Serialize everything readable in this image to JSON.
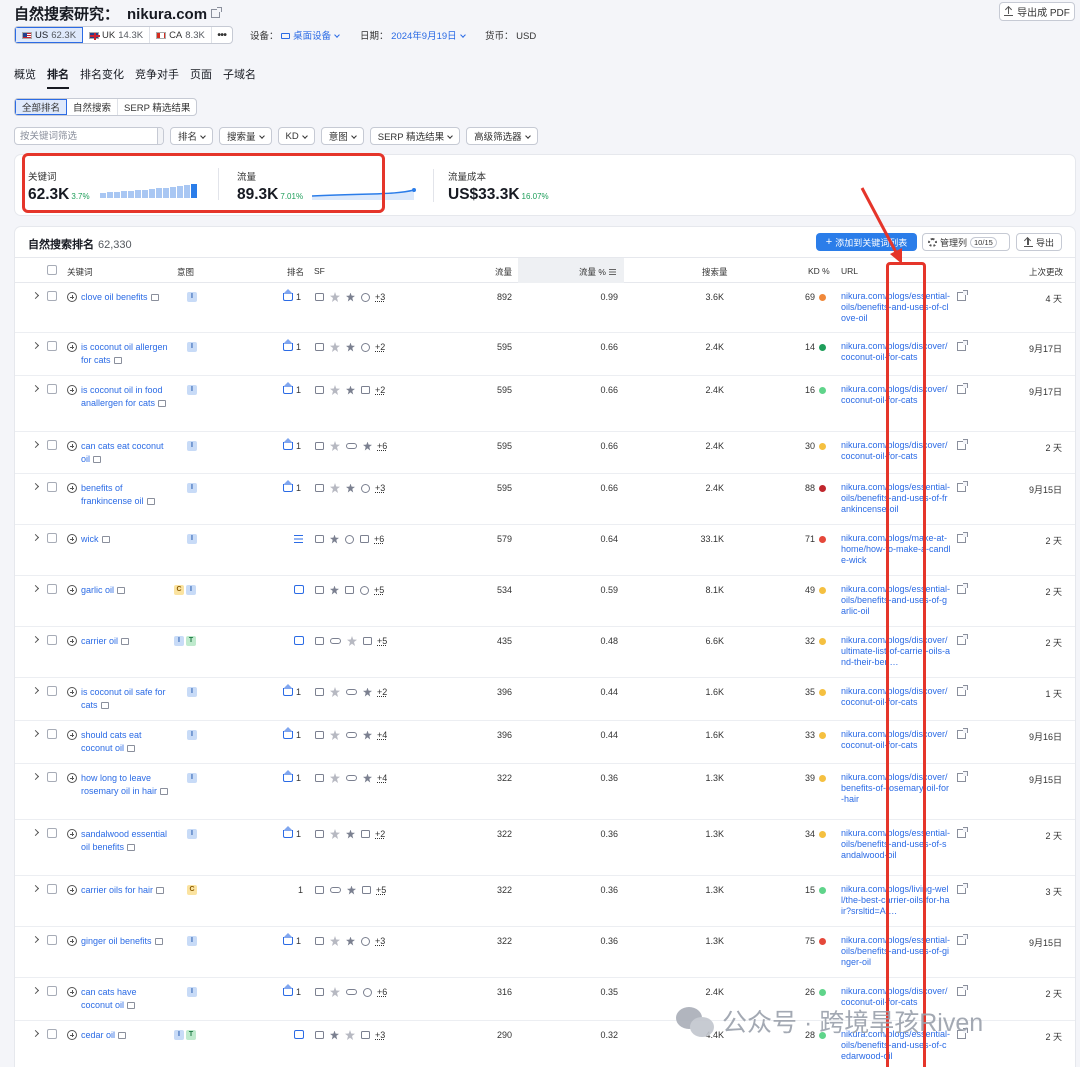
{
  "header": {
    "title": "自然搜索研究：",
    "domain": "nikura.com",
    "export_pdf": "导出成 PDF",
    "databases": [
      {
        "code": "US",
        "count": "62.3K",
        "flag": "us",
        "active": true
      },
      {
        "code": "UK",
        "count": "14.3K",
        "flag": "uk",
        "active": false
      },
      {
        "code": "CA",
        "count": "8.3K",
        "flag": "ca",
        "active": false
      }
    ],
    "more": "•••",
    "device_label": "设备：",
    "device_value": "桌面设备",
    "date_label": "日期：",
    "date_value": "2024年9月19日",
    "currency_label": "货币：",
    "currency_value": "USD"
  },
  "tabs": [
    "概览",
    "排名",
    "排名变化",
    "竞争对手",
    "页面",
    "子域名"
  ],
  "active_tab": 1,
  "subtabs": [
    "全部排名",
    "自然搜索",
    "SERP 精选结果"
  ],
  "filters": {
    "search_placeholder": "按关键词筛选",
    "buttons": [
      "排名",
      "搜索量",
      "KD",
      "意图",
      "SERP 精选结果",
      "高级筛选器"
    ]
  },
  "summary": {
    "keywords": {
      "label": "关键词",
      "value": "62.3K",
      "pct": "3.7%"
    },
    "traffic": {
      "label": "流量",
      "value": "89.3K",
      "pct": "7.01%"
    },
    "traffic_cost": {
      "label": "流量成本",
      "value": "US$33.3K",
      "pct": "16.07%"
    },
    "keyword_bars": [
      5,
      6,
      6,
      7,
      7,
      8,
      8,
      9,
      10,
      10,
      11,
      12,
      13,
      14
    ]
  },
  "table": {
    "title": "自然搜索排名",
    "count": "62,330",
    "add_button": "添加到关键词列表",
    "manage_button": "管理列",
    "manage_count": "10/15",
    "export_button": "导出",
    "columns": {
      "keyword": "关键词",
      "intent": "意图",
      "position": "排名",
      "sf": "SF",
      "traffic": "流量",
      "traffic_pct": "流量 %",
      "volume": "搜索量",
      "kd": "KD %",
      "url": "URL",
      "updated": "上次更改"
    },
    "rows": [
      {
        "keyword": "clove oil benefits",
        "intent": [
          "I"
        ],
        "pos": "1",
        "pos_type": "crown",
        "sf_more": "+3",
        "traffic": "892",
        "pct": "0.99",
        "volume": "3.6K",
        "kd": "69",
        "kd_color": "#f0883a",
        "url": "nikura.com/blogs/essential-oils/benefits-and-uses-of-clove-oil",
        "updated": "4 天"
      },
      {
        "keyword": "is coconut oil allergen for cats",
        "intent": [
          "I"
        ],
        "pos": "1",
        "pos_type": "crown",
        "sf_more": "+2",
        "traffic": "595",
        "pct": "0.66",
        "volume": "2.4K",
        "kd": "14",
        "kd_color": "#1e9e5a",
        "url": "nikura.com/blogs/discover/coconut-oil-for-cats",
        "updated": "9月17日"
      },
      {
        "keyword": "is coconut oil in food anallergen for cats",
        "intent": [
          "I"
        ],
        "pos": "1",
        "pos_type": "crown",
        "sf_more": "+2",
        "traffic": "595",
        "pct": "0.66",
        "volume": "2.4K",
        "kd": "16",
        "kd_color": "#5fd48a",
        "url": "nikura.com/blogs/discover/coconut-oil-for-cats",
        "updated": "9月17日"
      },
      {
        "keyword": "can cats eat coconut oil",
        "intent": [
          "I"
        ],
        "pos": "1",
        "pos_type": "crown",
        "sf_more": "+6",
        "traffic": "595",
        "pct": "0.66",
        "volume": "2.4K",
        "kd": "30",
        "kd_color": "#f5c040",
        "url": "nikura.com/blogs/discover/coconut-oil-for-cats",
        "updated": "2 天"
      },
      {
        "keyword": "benefits of frankincense oil",
        "intent": [
          "I"
        ],
        "pos": "1",
        "pos_type": "crown",
        "sf_more": "+3",
        "traffic": "595",
        "pct": "0.66",
        "volume": "2.4K",
        "kd": "88",
        "kd_color": "#c0262d",
        "url": "nikura.com/blogs/essential-oils/benefits-and-uses-of-frankincense-oil",
        "updated": "9月15日"
      },
      {
        "keyword": "wick",
        "intent": [
          "I"
        ],
        "pos": "",
        "pos_type": "list",
        "sf_more": "+6",
        "traffic": "579",
        "pct": "0.64",
        "volume": "33.1K",
        "kd": "71",
        "kd_color": "#e5483a",
        "url": "nikura.com/blogs/make-at-home/how-to-make-a-candle-wick",
        "updated": "2 天"
      },
      {
        "keyword": "garlic oil",
        "intent": [
          "C",
          "I"
        ],
        "pos": "",
        "pos_type": "chat",
        "sf_more": "+5",
        "traffic": "534",
        "pct": "0.59",
        "volume": "8.1K",
        "kd": "49",
        "kd_color": "#f5c040",
        "url": "nikura.com/blogs/essential-oils/benefits-and-uses-of-garlic-oil",
        "updated": "2 天"
      },
      {
        "keyword": "carrier oil",
        "intent": [
          "I",
          "T"
        ],
        "pos": "",
        "pos_type": "chat",
        "sf_more": "+5",
        "traffic": "435",
        "pct": "0.48",
        "volume": "6.6K",
        "kd": "32",
        "kd_color": "#f5c040",
        "url": "nikura.com/blogs/discover/ultimate-list-of-carrier-oils-and-their-ben…",
        "updated": "2 天"
      },
      {
        "keyword": "is coconut oil safe for cats",
        "intent": [
          "I"
        ],
        "pos": "1",
        "pos_type": "crown",
        "sf_more": "+2",
        "traffic": "396",
        "pct": "0.44",
        "volume": "1.6K",
        "kd": "35",
        "kd_color": "#f5c040",
        "url": "nikura.com/blogs/discover/coconut-oil-for-cats",
        "updated": "1 天"
      },
      {
        "keyword": "should cats eat coconut oil",
        "intent": [
          "I"
        ],
        "pos": "1",
        "pos_type": "crown",
        "sf_more": "+4",
        "traffic": "396",
        "pct": "0.44",
        "volume": "1.6K",
        "kd": "33",
        "kd_color": "#f5c040",
        "url": "nikura.com/blogs/discover/coconut-oil-for-cats",
        "updated": "9月16日"
      },
      {
        "keyword": "how long to leave rosemary oil in hair",
        "intent": [
          "I"
        ],
        "pos": "1",
        "pos_type": "crown",
        "sf_more": "+4",
        "traffic": "322",
        "pct": "0.36",
        "volume": "1.3K",
        "kd": "39",
        "kd_color": "#f5c040",
        "url": "nikura.com/blogs/discover/benefits-of-rosemary-oil-for-hair",
        "updated": "9月15日"
      },
      {
        "keyword": "sandalwood essential oil benefits",
        "intent": [
          "I"
        ],
        "pos": "1",
        "pos_type": "crown",
        "sf_more": "+2",
        "traffic": "322",
        "pct": "0.36",
        "volume": "1.3K",
        "kd": "34",
        "kd_color": "#f5c040",
        "url": "nikura.com/blogs/essential-oils/benefits-and-uses-of-sandalwood-oil",
        "updated": "2 天"
      },
      {
        "keyword": "carrier oils for hair",
        "intent": [
          "C"
        ],
        "pos": "1",
        "pos_type": "plain",
        "sf_more": "+5",
        "traffic": "322",
        "pct": "0.36",
        "volume": "1.3K",
        "kd": "15",
        "kd_color": "#5fd48a",
        "url": "nikura.com/blogs/living-well/the-best-carrier-oils-for-hair?srsltid=Af…",
        "updated": "3 天"
      },
      {
        "keyword": "ginger oil benefits",
        "intent": [
          "I"
        ],
        "pos": "1",
        "pos_type": "crown",
        "sf_more": "+3",
        "traffic": "322",
        "pct": "0.36",
        "volume": "1.3K",
        "kd": "75",
        "kd_color": "#e5483a",
        "url": "nikura.com/blogs/essential-oils/benefits-and-uses-of-ginger-oil",
        "updated": "9月15日"
      },
      {
        "keyword": "can cats have coconut oil",
        "intent": [
          "I"
        ],
        "pos": "1",
        "pos_type": "crown",
        "sf_more": "+6",
        "traffic": "316",
        "pct": "0.35",
        "volume": "2.4K",
        "kd": "26",
        "kd_color": "#5fd48a",
        "url": "nikura.com/blogs/discover/coconut-oil-for-cats",
        "updated": "2 天"
      },
      {
        "keyword": "cedar oil",
        "intent": [
          "I",
          "T"
        ],
        "pos": "",
        "pos_type": "chat",
        "sf_more": "+3",
        "traffic": "290",
        "pct": "0.32",
        "volume": "4.4K",
        "kd": "28",
        "kd_color": "#5fd48a",
        "url": "nikura.com/blogs/essential-oils/benefits-and-uses-of-cedarwood-oil",
        "updated": "2 天"
      }
    ]
  },
  "watermark": "公众号 · 跨境旱孩Riven"
}
